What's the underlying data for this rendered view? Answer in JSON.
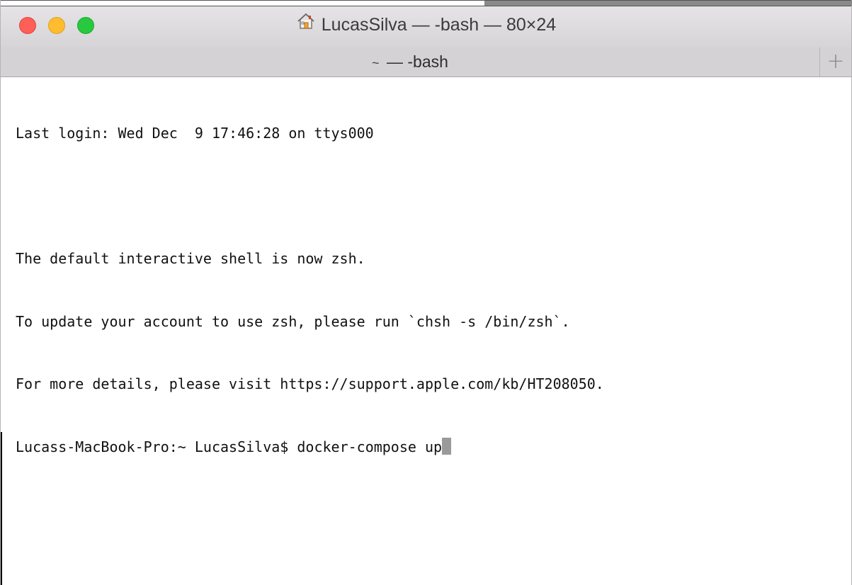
{
  "window": {
    "title": "LucasSilva — -bash — 80×24",
    "title_icon": "home-icon"
  },
  "tabbar": {
    "tab_label_prefix": "~",
    "tab_label": "— -bash",
    "new_tab_icon": "plus-icon",
    "new_tab_glyph": "+"
  },
  "terminal": {
    "lines": [
      "Last login: Wed Dec  9 17:46:28 on ttys000",
      "",
      "The default interactive shell is now zsh.",
      "To update your account to use zsh, please run `chsh -s /bin/zsh`.",
      "For more details, please visit https://support.apple.com/kb/HT208050."
    ],
    "prompt": "Lucass-MacBook-Pro:~ LucasSilva$ ",
    "command": "docker-compose up"
  },
  "colors": {
    "close": "#fe5f57",
    "minimize": "#febc2e",
    "maximize": "#28c840"
  }
}
